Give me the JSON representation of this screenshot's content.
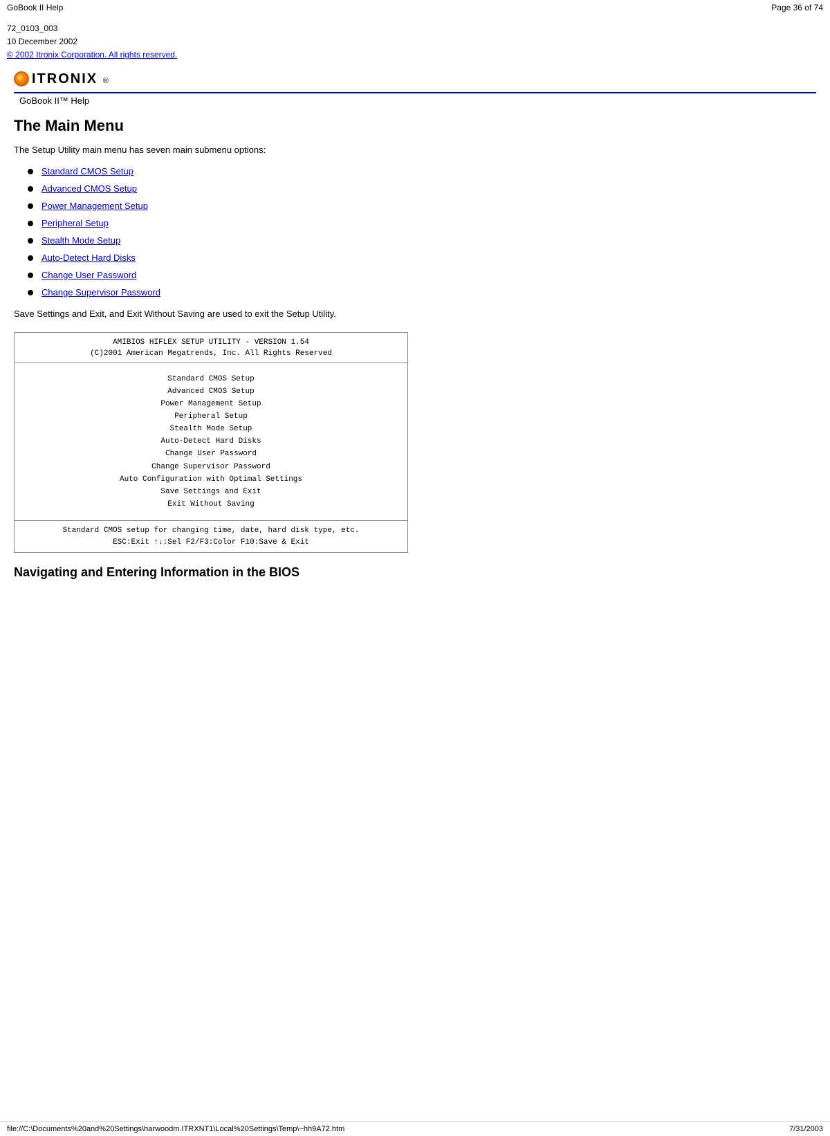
{
  "topbar": {
    "title": "GoBook II Help",
    "page": "Page 36 of 74"
  },
  "meta": {
    "doc_id": "72_0103_003",
    "date": "10 December 2002",
    "copyright": "© 2002 Itronix Corporation.  All rights reserved."
  },
  "logo": {
    "brand": "ITRONIX",
    "header_label": "GoBook II™ Help"
  },
  "main_menu": {
    "title": "The Main Menu",
    "intro": "The Setup Utility main menu has seven main submenu options:",
    "items": [
      {
        "label": "Standard CMOS Setup"
      },
      {
        "label": "Advanced CMOS Setup"
      },
      {
        "label": "Power Management Setup"
      },
      {
        "label": "Peripheral Setup"
      },
      {
        "label": "Stealth Mode Setup"
      },
      {
        "label": "Auto-Detect Hard Disks"
      },
      {
        "label": "Change User Password"
      },
      {
        "label": "Change Supervisor Password"
      }
    ],
    "save_text": "Save Settings and Exit, and Exit Without Saving are used to exit the Setup Utility."
  },
  "bios_screen": {
    "header_line1": "AMIBIOS HIFLEX SETUP UTILITY - VERSION 1.54",
    "header_line2": "(C)2001 American Megatrends, Inc. All Rights Reserved",
    "menu_items": [
      "Standard CMOS Setup",
      "Advanced CMOS Setup",
      "Power Management Setup",
      "Peripheral Setup",
      "Stealth Mode Setup",
      "Auto-Detect Hard Disks",
      "Change User Password",
      "Change Supervisor Password",
      "Auto Configuration with Optimal Settings",
      "Save Settings and Exit",
      "Exit Without Saving"
    ],
    "footer_line1": "Standard CMOS setup for changing time, date, hard disk type, etc.",
    "footer_line2": "ESC:Exit  ↑↓:Sel  F2/F3:Color  F10:Save & Exit"
  },
  "nav_section": {
    "title": "Navigating and Entering Information in the BIOS"
  },
  "bottombar": {
    "path": "file://C:\\Documents%20and%20Settings\\harwoodm.ITRXNT1\\Local%20Settings\\Temp\\~hh9A72.htm",
    "date": "7/31/2003"
  }
}
